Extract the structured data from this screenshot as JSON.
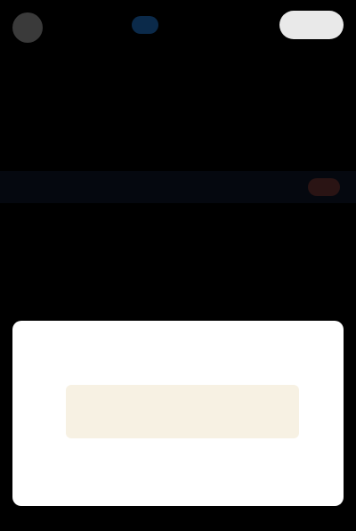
{
  "header": {
    "account_name": "",
    "follow_label": ""
  },
  "post": {
    "paragraph_1": "",
    "link_text": "",
    "paragraph_3": ""
  },
  "card": {
    "banner_text": ""
  },
  "colors": {
    "background": "#000000",
    "card_background": "#ffffff",
    "banner_text": "#c8a96a",
    "link": "#4a79b8"
  }
}
